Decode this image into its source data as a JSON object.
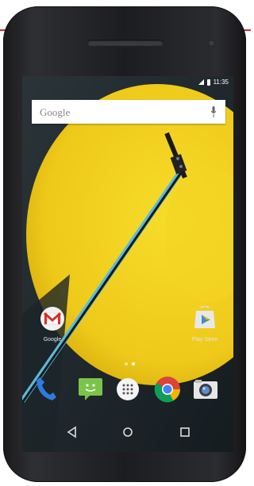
{
  "status": {
    "time": "11:35"
  },
  "search": {
    "brand": "Google"
  },
  "home": {
    "apps": [
      {
        "label": "Google",
        "icon": "gmail-icon"
      },
      {
        "label": "Play Store",
        "icon": "play-store-icon"
      }
    ],
    "page_count": 2,
    "active_page": 2
  },
  "dock": {
    "items": [
      "phone-icon",
      "messenger-icon",
      "app-drawer-icon",
      "chrome-icon",
      "camera-icon"
    ]
  },
  "nav": {
    "items": [
      "back-icon",
      "home-icon",
      "recents-icon"
    ]
  },
  "colors": {
    "wallpaper_yellow": "#f2d21b",
    "wallpaper_dark": "#1e272c",
    "accent_teal": "#4aa8c6"
  }
}
